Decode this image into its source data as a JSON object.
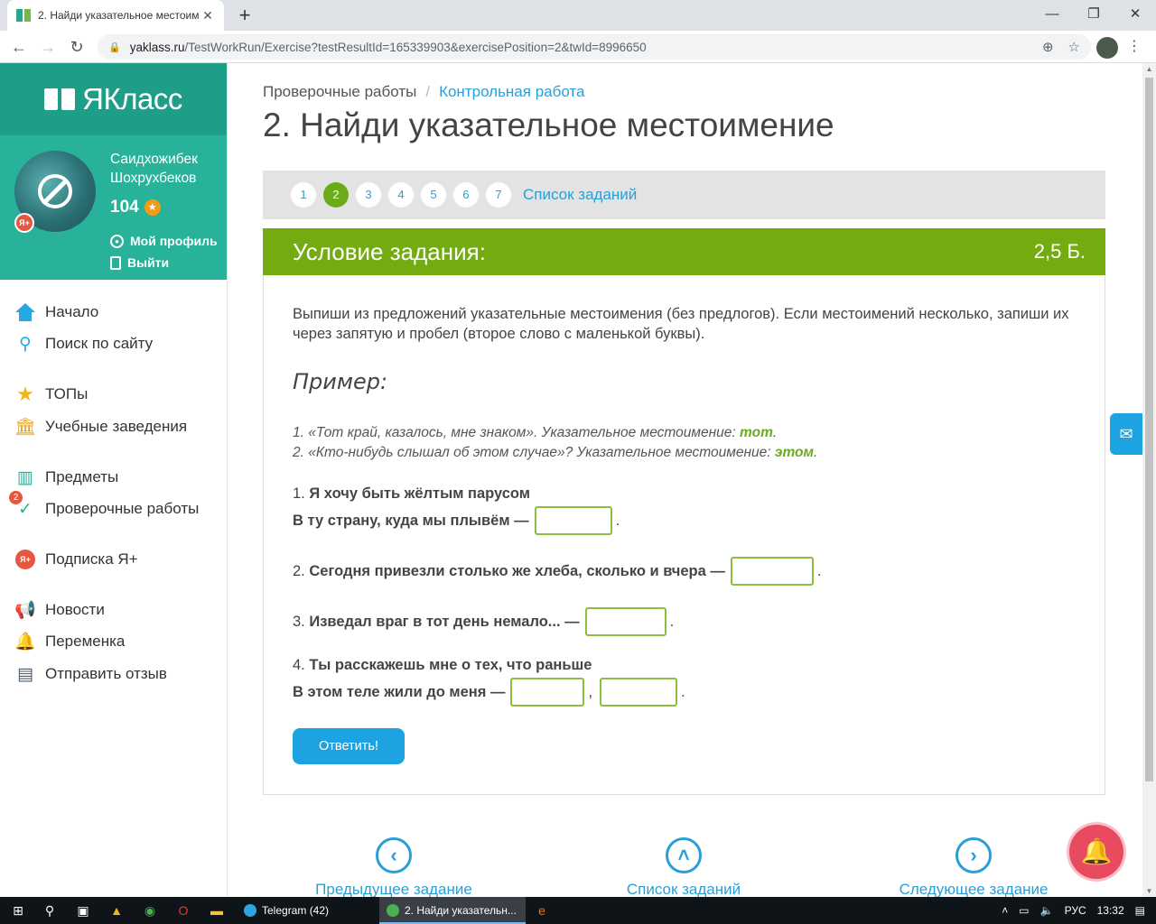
{
  "browser": {
    "tab_title": "2. Найди указательное местоим",
    "url_domain": "yaklass.ru",
    "url_path": "/TestWorkRun/Exercise?testResultId=165339903&exercisePosition=2&twId=8996650"
  },
  "sidebar": {
    "logo": "ЯКласс",
    "user": {
      "first_line": "Саидхожибек",
      "second_line": "Шохрухбеков",
      "points": "104",
      "profile_link": "Мой профиль",
      "logout_link": "Выйти",
      "yaplus_badge": "Я+"
    },
    "items": [
      {
        "label": "Начало",
        "icon": "home-icon"
      },
      {
        "label": "Поиск по сайту",
        "icon": "search-icon"
      },
      {
        "label": "ТОПы",
        "icon": "star-icon"
      },
      {
        "label": "Учебные заведения",
        "icon": "institution-icon"
      },
      {
        "label": "Предметы",
        "icon": "book-icon"
      },
      {
        "label": "Проверочные работы",
        "icon": "check-icon",
        "badge": "2"
      },
      {
        "label": "Подписка Я+",
        "icon": "yaplus-icon"
      },
      {
        "label": "Новости",
        "icon": "megaphone-icon"
      },
      {
        "label": "Переменка",
        "icon": "bell-icon"
      },
      {
        "label": "Отправить отзыв",
        "icon": "feedback-icon"
      }
    ]
  },
  "main": {
    "breadcrumb_root": "Проверочные работы",
    "breadcrumb_sep": "/",
    "breadcrumb_current": "Контрольная работа",
    "title": "2. Найди указательное местоимение",
    "steps": [
      "1",
      "2",
      "3",
      "4",
      "5",
      "6",
      "7"
    ],
    "active_step": "2",
    "task_list_link": "Список заданий",
    "condition_title": "Условие задания:",
    "points": "2,5 Б.",
    "instructions": "Выпиши из предложений указательные местоимения (без предлогов). Если местоимений несколько, запиши их через запятую и пробел (второе слово с маленькой буквы).",
    "example_title": "Пример:",
    "example1_text": "1. «Тот край, казалось, мне знаком». Указательное местоимение: ",
    "example1_answer": "тот",
    "example2_text": "2. «Кто-нибудь слышал об этом случае»? Указательное местоимение: ",
    "example2_answer": "этом",
    "q1_num": "1.",
    "q1_line1": "Я хочу быть жёлтым парусом",
    "q1_line2": "В ту страну, куда мы плывём —",
    "q2_num": "2.",
    "q2_text": "Сегодня привезли столько же хлеба, сколько и вчера —",
    "q3_num": "3.",
    "q3_text": "Изведал враг в тот день немало... —",
    "q4_num": "4.",
    "q4_line1": "Ты расскажешь мне о тех, что раньше",
    "q4_line2": "В этом теле жили до меня —",
    "submit_label": "Ответить!",
    "prev_label": "Предыдущее задание",
    "list_label": "Список заданий",
    "next_label": "Следующее задание"
  },
  "taskbar": {
    "app1": "Telegram (42)",
    "app2": "2. Найди указательн...",
    "lang": "РУС",
    "time": "13:32"
  },
  "colors": {
    "brand_dark": "#1e9d87",
    "brand": "#27b299",
    "task_header": "#74ab11",
    "link": "#2a9fd6",
    "button": "#1ea3e2"
  }
}
